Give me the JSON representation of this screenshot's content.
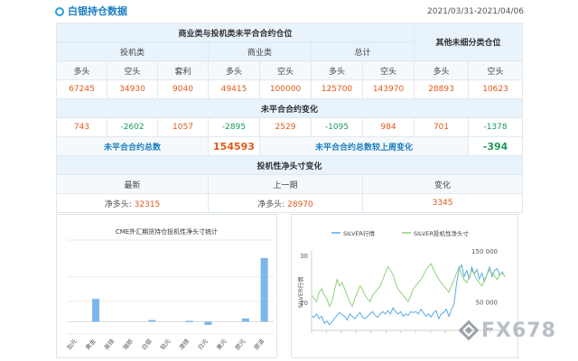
{
  "header": {
    "title": "白银持仓数据",
    "date_range": "2021/03/31-2021/04/06"
  },
  "table": {
    "group_main": "商业类与投机类未平合合约仓位",
    "group_other": "其他未细分类仓位",
    "speculative": "投机类",
    "commercial": "商业类",
    "total": "总计",
    "long": "多头",
    "short": "空头",
    "spread": "套利",
    "values": {
      "spec_long": "67245",
      "spec_short": "34930",
      "spec_spread": "9040",
      "comm_long": "49415",
      "comm_short": "100000",
      "total_long": "125700",
      "total_short": "143970",
      "other_long": "28893",
      "other_short": "10623"
    },
    "change_title": "未平合合约变化",
    "changes": [
      "743",
      "-2602",
      "1057",
      "-2895",
      "2529",
      "-1095",
      "984",
      "701",
      "-1378"
    ],
    "oi_total_label": "未平合合约总数",
    "oi_total_value": "154593",
    "oi_change_label": "未平合合约总数较上周变化",
    "oi_change_value": "-394",
    "spec_title": "投机性净头寸变化",
    "latest": "最新",
    "previous": "上一期",
    "change": "变化",
    "net_long_label": "净多头:",
    "net_latest": "32315",
    "net_prev": "28970",
    "net_change": "3345"
  },
  "bar_chart": {
    "title": "CME外汇期货持仓投机性净头寸统计",
    "chart_data": {
      "type": "bar",
      "categories": [
        "加元",
        "黄金",
        "英镑",
        "瑞郎",
        "白银",
        "铂元",
        "澳镑",
        "日元",
        "美元",
        "欧元",
        "原油"
      ],
      "values": [
        0,
        0.28,
        0,
        0,
        0.02,
        0,
        0.01,
        -0.04,
        0,
        0.04,
        0.78
      ],
      "ylim": [
        -0.15,
        1.0
      ]
    }
  },
  "line_chart": {
    "chart_data": {
      "type": "line",
      "legend": [
        "SILVER行情",
        "SILVER投机性净头寸"
      ],
      "left_axis_ticks": [
        "30",
        "20"
      ],
      "right_axis_ticks": [
        "150 000",
        "50 000"
      ],
      "ylabel_left": "SILVER行情",
      "series": [
        {
          "name": "SILVER行情",
          "color": "#5aa9e6",
          "values": [
            17,
            16.8,
            17.5,
            16.5,
            17,
            15.5,
            16,
            15.2,
            15.8,
            16.5,
            17.2,
            17.8,
            17.3,
            17,
            16.2,
            17.5,
            17,
            16.5,
            17.2,
            17.8,
            16.8,
            16.5,
            17,
            17.5,
            18,
            17.2,
            16.8,
            17.5,
            18,
            17.5,
            18.2,
            17.5,
            18.8,
            18,
            17.5,
            18,
            17,
            17.5,
            17.2,
            18,
            17.8,
            18,
            17.5,
            18.5,
            17.8,
            17,
            17.5,
            16.8,
            17.8,
            18.2,
            16.5,
            17.5,
            17.8,
            18.5,
            17,
            18.5,
            19.5,
            24,
            27,
            28,
            25.5,
            26.8,
            25,
            27.5,
            26,
            27,
            25,
            26.2,
            24.5,
            26,
            27.5,
            25.5,
            26.8,
            27.2,
            25.8,
            26.5,
            25.5
          ]
        },
        {
          "name": "SILVER投机性净头寸",
          "color": "#8fd27a",
          "values": [
            42,
            40,
            38,
            44,
            46,
            42,
            40,
            35,
            38,
            45,
            52,
            48,
            50,
            46,
            42,
            38,
            35,
            40,
            44,
            48,
            46,
            42,
            40,
            38,
            42,
            44,
            46,
            48,
            52,
            56,
            60,
            58,
            55,
            50,
            46,
            44,
            42,
            40,
            38,
            42,
            46,
            48,
            50,
            52,
            55,
            58,
            60,
            62,
            58,
            55,
            52,
            50,
            48,
            46,
            44,
            48,
            52,
            56,
            60,
            55,
            52,
            50,
            54,
            58,
            55,
            52,
            50,
            48,
            52,
            55,
            58,
            56,
            54,
            52,
            55,
            56,
            54
          ]
        }
      ]
    }
  }
}
